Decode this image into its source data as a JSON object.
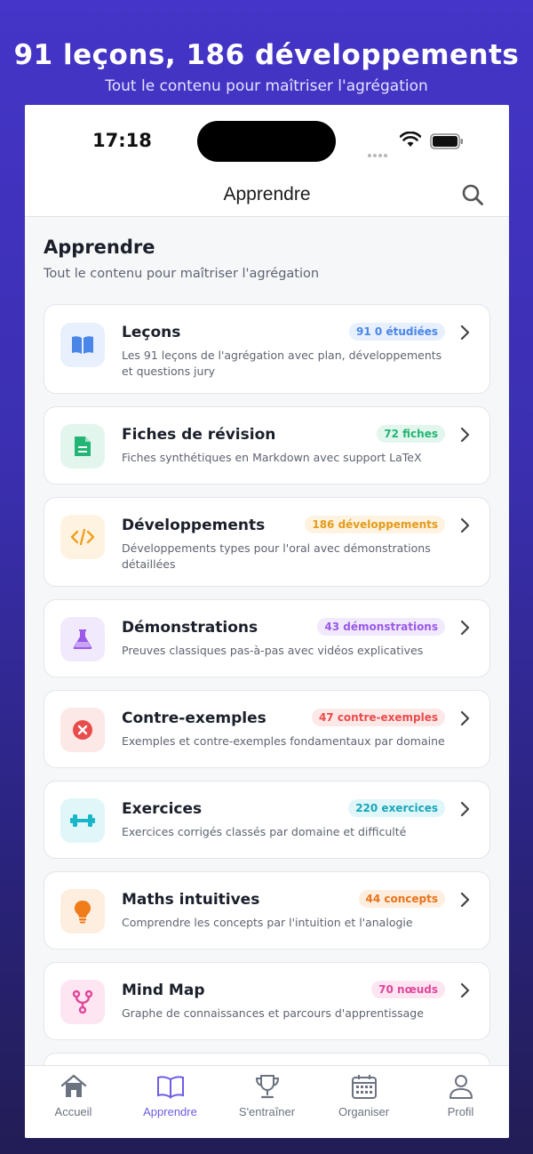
{
  "hero": {
    "title": "91 leçons, 186 développements",
    "subtitle": "Tout le contenu pour maîtriser l'agrégation"
  },
  "status": {
    "time": "17:18"
  },
  "nav": {
    "title": "Apprendre",
    "search_icon": "search-icon"
  },
  "section": {
    "title": "Apprendre",
    "subtitle": "Tout le contenu pour maîtriser l'agrégation"
  },
  "cards": [
    {
      "title": "Leçons",
      "badge": "91 0 étudiées",
      "desc": "Les 91 leçons de l'agrégation avec plan, développements et questions jury",
      "icon": "book-icon",
      "color": "#4a86e8",
      "bg": "#e8f0fd"
    },
    {
      "title": "Fiches de révision",
      "badge": "72 fiches",
      "desc": "Fiches synthétiques en Markdown avec support LaTeX",
      "icon": "document-icon",
      "color": "#22b573",
      "bg": "#e3f6ee"
    },
    {
      "title": "Développements",
      "badge": "186 développements",
      "desc": "Développements types pour l'oral avec démonstrations détaillées",
      "icon": "code-icon",
      "color": "#f0a020",
      "bg": "#fef3e0"
    },
    {
      "title": "Démonstrations",
      "badge": "43 démonstrations",
      "desc": "Preuves classiques pas-à-pas avec vidéos explicatives",
      "icon": "flask-icon",
      "color": "#9b59e8",
      "bg": "#f1eafd"
    },
    {
      "title": "Contre-exemples",
      "badge": "47 contre-exemples",
      "desc": "Exemples et contre-exemples fondamentaux par domaine",
      "icon": "x-circle-icon",
      "color": "#e84c4c",
      "bg": "#fde8e8"
    },
    {
      "title": "Exercices",
      "badge": "220 exercices",
      "desc": "Exercices corrigés classés par domaine et difficulté",
      "icon": "dumbbell-icon",
      "color": "#19b6c9",
      "bg": "#e0f6f9"
    },
    {
      "title": "Maths intuitives",
      "badge": "44 concepts",
      "desc": "Comprendre les concepts par l'intuition et l'analogie",
      "icon": "lightbulb-icon",
      "color": "#f07c1a",
      "bg": "#fdeee0"
    },
    {
      "title": "Mind Map",
      "badge": "70 nœuds",
      "desc": "Graphe de connaissances et parcours d'apprentissage",
      "icon": "fork-icon",
      "color": "#e0479b",
      "bg": "#fde6f1"
    }
  ],
  "tabs": [
    {
      "label": "Accueil",
      "icon": "home-icon",
      "active": false
    },
    {
      "label": "Apprendre",
      "icon": "book-open-icon",
      "active": true
    },
    {
      "label": "S'entraîner",
      "icon": "trophy-icon",
      "active": false
    },
    {
      "label": "Organiser",
      "icon": "calendar-icon",
      "active": false
    },
    {
      "label": "Profil",
      "icon": "user-icon",
      "active": false
    }
  ],
  "colors": {
    "accent": "#6c5ce7",
    "background_top": "#4535c8",
    "background_bottom": "#221d55"
  }
}
